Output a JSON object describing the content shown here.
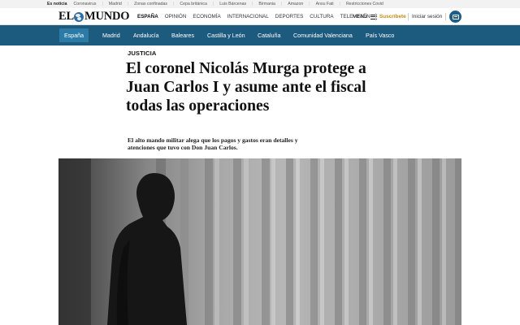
{
  "trending": {
    "lead": "Es noticia",
    "items": [
      "Coronavirus",
      "Madrid",
      "Zonas confinadas",
      "Cepa británica",
      "Luis Bárcenas",
      "Birmania",
      "Amazon",
      "Ansu Fati",
      "Restricciones Covid"
    ]
  },
  "masthead": {
    "logo_left": "EL",
    "logo_right": "MUNDO",
    "nav": [
      "ESPAÑA",
      "OPINIÓN",
      "ECONOMÍA",
      "INTERNACIONAL",
      "DEPORTES",
      "CULTURA",
      "TELEVISIÓN"
    ],
    "active_nav": "ESPAÑA",
    "menu_label": "MENÚ",
    "subscribe_label": "Suscríbete",
    "login_label": "Iniciar sesión",
    "kiosk_icon": "kiosk-newspaper-icon"
  },
  "regions": {
    "items": [
      "España",
      "Madrid",
      "Andalucía",
      "Baleares",
      "Castilla y León",
      "Cataluña",
      "Comunidad Valenciana",
      "País Vasco"
    ],
    "active": "España"
  },
  "article": {
    "kicker": "JUSTICIA",
    "headline": "El coronel Nicolás Murga protege a Juan Carlos I y asume ante el fiscal todas las operaciones",
    "subhead": "El alto mando militar alega que los pagos y gastos eran detalles y atenciones que tuvo con Don Juan Carlos."
  },
  "colors": {
    "region_bar": "#1c5a7e",
    "region_active": "#2c7aa6",
    "subscribe": "#c28a1a",
    "kiosk": "#1e5c86"
  }
}
